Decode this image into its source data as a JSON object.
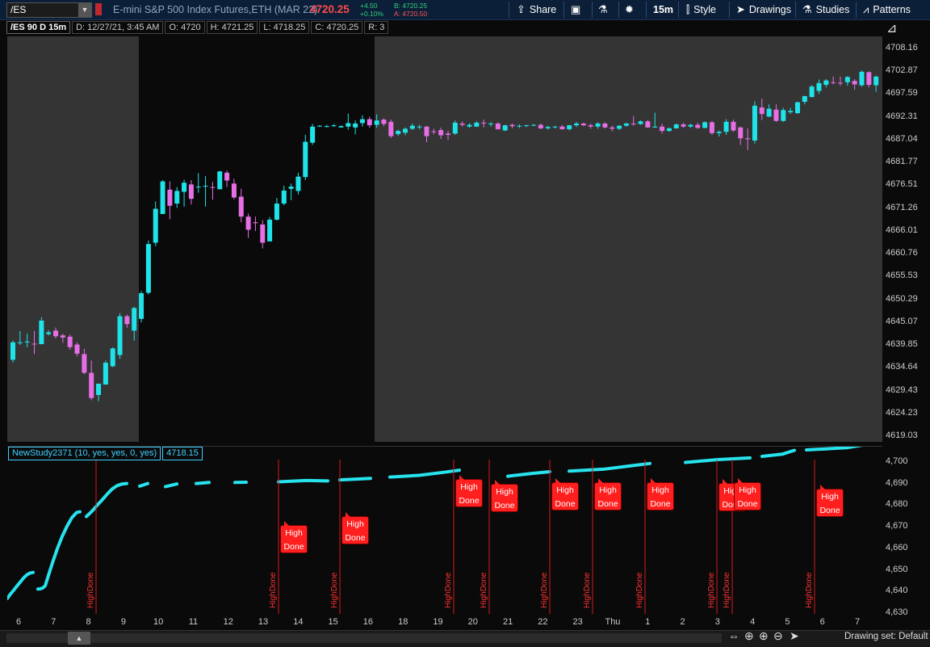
{
  "toolbar": {
    "symbol": "/ES",
    "instrument_name": "E-mini S&P 500 Index Futures,ETH (MAR 22)",
    "last_price": "4720.25",
    "net_change": "+4.50",
    "pct_change": "+0.10%",
    "bid": "B: 4720.25",
    "ask": "A: 4720.50",
    "share_label": "Share",
    "timeframe_label": "15m",
    "style_label": "Style",
    "drawings_label": "Drawings",
    "studies_label": "Studies",
    "patterns_label": "Patterns"
  },
  "chart_header": {
    "symbol_period": "/ES 90 D 15m",
    "date": "D: 12/27/21, 3:45 AM",
    "open": "O: 4720",
    "high": "H: 4721.25",
    "low": "L: 4718.25",
    "close": "C: 4720.25",
    "range": "R: 3"
  },
  "colors": {
    "up_candle": "#1fe3e8",
    "down_candle": "#e66fe6",
    "study_line": "#26e3ee",
    "high_done_marker": "#ff1f1f"
  },
  "price_axis": {
    "ticks": [
      "4708.16",
      "4702.87",
      "4697.59",
      "4692.31",
      "4687.04",
      "4681.77",
      "4676.51",
      "4671.26",
      "4666.01",
      "4660.76",
      "4655.53",
      "4650.29",
      "4645.07",
      "4639.85",
      "4634.64",
      "4629.43",
      "4624.23",
      "4619.03"
    ]
  },
  "study": {
    "name": "NewStudy2371 (10, yes, yes, 0, yes)",
    "value": "4718.15",
    "axis_ticks": [
      "4,700",
      "4,690",
      "4,680",
      "4,670",
      "4,660",
      "4,650",
      "4,640",
      "4,630"
    ],
    "vertical_label": "HighDone",
    "marker_line1": "High",
    "marker_line2": "Done"
  },
  "time_axis": {
    "ticks": [
      "6",
      "7",
      "8",
      "9",
      "10",
      "11",
      "12",
      "13",
      "14",
      "15",
      "16",
      "18",
      "19",
      "20",
      "21",
      "22",
      "23",
      "Thu",
      "1",
      "2",
      "3",
      "4",
      "5",
      "6",
      "7"
    ]
  },
  "bottom_bar": {
    "drawing_set": "Drawing set: Default"
  },
  "chart_data": {
    "type": "candlestick",
    "symbol": "/ES",
    "interval": "15m",
    "ylim": [
      4619.03,
      4708.16
    ],
    "candles": [
      {
        "o": 4636.6,
        "h": 4641.0,
        "l": 4636.0,
        "c": 4640.6
      },
      {
        "o": 4640.6,
        "h": 4643.2,
        "l": 4640.0,
        "c": 4640.6
      },
      {
        "o": 4640.6,
        "h": 4642.6,
        "l": 4639.5,
        "c": 4640.8
      },
      {
        "o": 4640.3,
        "h": 4643.2,
        "l": 4637.9,
        "c": 4640.2
      },
      {
        "o": 4640.2,
        "h": 4646.4,
        "l": 4640.1,
        "c": 4645.6
      },
      {
        "o": 4642.5,
        "h": 4643.4,
        "l": 4642.2,
        "c": 4642.9
      },
      {
        "o": 4643.3,
        "h": 4644.0,
        "l": 4641.5,
        "c": 4642.0
      },
      {
        "o": 4642.2,
        "h": 4642.6,
        "l": 4640.5,
        "c": 4641.7
      },
      {
        "o": 4641.9,
        "h": 4642.4,
        "l": 4638.9,
        "c": 4639.5
      },
      {
        "o": 4640.1,
        "h": 4640.6,
        "l": 4637.4,
        "c": 4638.0
      },
      {
        "o": 4637.9,
        "h": 4639.1,
        "l": 4633.3,
        "c": 4633.6
      },
      {
        "o": 4633.6,
        "h": 4636.4,
        "l": 4627.3,
        "c": 4627.8
      },
      {
        "o": 4628.5,
        "h": 4631.1,
        "l": 4627.1,
        "c": 4631.1
      },
      {
        "o": 4630.9,
        "h": 4636.4,
        "l": 4630.9,
        "c": 4635.9
      },
      {
        "o": 4635.1,
        "h": 4639.5,
        "l": 4634.9,
        "c": 4639.2
      },
      {
        "o": 4637.7,
        "h": 4647.3,
        "l": 4636.8,
        "c": 4646.6
      },
      {
        "o": 4646.6,
        "h": 4647.0,
        "l": 4644.0,
        "c": 4644.8
      },
      {
        "o": 4643.3,
        "h": 4648.8,
        "l": 4641.0,
        "c": 4648.5
      },
      {
        "o": 4646.0,
        "h": 4652.4,
        "l": 4645.2,
        "c": 4651.9
      },
      {
        "o": 4652.0,
        "h": 4664.0,
        "l": 4651.6,
        "c": 4663.2
      },
      {
        "o": 4663.5,
        "h": 4673.0,
        "l": 4662.7,
        "c": 4671.3
      },
      {
        "o": 4670.1,
        "h": 4677.9,
        "l": 4670.2,
        "c": 4677.6
      },
      {
        "o": 4675.7,
        "h": 4677.6,
        "l": 4668.9,
        "c": 4672.0
      },
      {
        "o": 4672.5,
        "h": 4676.3,
        "l": 4671.5,
        "c": 4675.4
      },
      {
        "o": 4675.2,
        "h": 4678.0,
        "l": 4671.8,
        "c": 4677.3
      },
      {
        "o": 4676.9,
        "h": 4677.9,
        "l": 4672.3,
        "c": 4673.6
      },
      {
        "o": 4676.3,
        "h": 4679.5,
        "l": 4675.0,
        "c": 4676.4
      },
      {
        "o": 4676.5,
        "h": 4678.8,
        "l": 4671.8,
        "c": 4676.6
      },
      {
        "o": 4676.3,
        "h": 4677.5,
        "l": 4673.4,
        "c": 4676.2
      },
      {
        "o": 4675.8,
        "h": 4680.0,
        "l": 4675.8,
        "c": 4679.9
      },
      {
        "o": 4679.6,
        "h": 4680.1,
        "l": 4676.3,
        "c": 4677.8
      },
      {
        "o": 4677.1,
        "h": 4678.2,
        "l": 4673.5,
        "c": 4673.9
      },
      {
        "o": 4674.1,
        "h": 4675.9,
        "l": 4668.2,
        "c": 4669.5
      },
      {
        "o": 4669.5,
        "h": 4670.2,
        "l": 4664.6,
        "c": 4666.5
      },
      {
        "o": 4668.2,
        "h": 4669.5,
        "l": 4666.2,
        "c": 4668.0
      },
      {
        "o": 4667.7,
        "h": 4668.7,
        "l": 4662.2,
        "c": 4663.5
      },
      {
        "o": 4663.8,
        "h": 4669.4,
        "l": 4664.0,
        "c": 4668.8
      },
      {
        "o": 4668.8,
        "h": 4673.8,
        "l": 4668.6,
        "c": 4672.5
      },
      {
        "o": 4672.5,
        "h": 4676.6,
        "l": 4672.1,
        "c": 4675.5
      },
      {
        "o": 4675.9,
        "h": 4677.1,
        "l": 4673.3,
        "c": 4676.4
      },
      {
        "o": 4675.4,
        "h": 4679.6,
        "l": 4674.6,
        "c": 4678.7
      },
      {
        "o": 4678.6,
        "h": 4688.3,
        "l": 4677.9,
        "c": 4686.7
      },
      {
        "o": 4686.5,
        "h": 4690.8,
        "l": 4686.0,
        "c": 4690.2
      },
      {
        "o": 4690.3,
        "h": 4690.5,
        "l": 4690.1,
        "c": 4690.4
      },
      {
        "o": 4690.2,
        "h": 4690.6,
        "l": 4690.0,
        "c": 4690.3
      },
      {
        "o": 4690.4,
        "h": 4690.8,
        "l": 4690.1,
        "c": 4690.5
      },
      {
        "o": 4690.0,
        "h": 4690.5,
        "l": 4690.0,
        "c": 4690.3
      },
      {
        "o": 4690.2,
        "h": 4693.2,
        "l": 4689.5,
        "c": 4691.0
      },
      {
        "o": 4690.0,
        "h": 4691.6,
        "l": 4688.4,
        "c": 4690.9
      },
      {
        "o": 4691.0,
        "h": 4692.8,
        "l": 4690.2,
        "c": 4691.9
      },
      {
        "o": 4691.9,
        "h": 4692.5,
        "l": 4689.9,
        "c": 4690.5
      },
      {
        "o": 4690.6,
        "h": 4693.0,
        "l": 4689.9,
        "c": 4691.6
      },
      {
        "o": 4691.8,
        "h": 4692.1,
        "l": 4690.3,
        "c": 4690.8
      },
      {
        "o": 4691.3,
        "h": 4691.8,
        "l": 4687.6,
        "c": 4688.0
      },
      {
        "o": 4688.5,
        "h": 4689.5,
        "l": 4688.1,
        "c": 4689.2
      },
      {
        "o": 4688.8,
        "h": 4690.0,
        "l": 4688.2,
        "c": 4689.7
      },
      {
        "o": 4689.7,
        "h": 4690.9,
        "l": 4689.4,
        "c": 4690.4
      },
      {
        "o": 4690.1,
        "h": 4690.6,
        "l": 4689.6,
        "c": 4690.2
      },
      {
        "o": 4690.2,
        "h": 4690.3,
        "l": 4686.6,
        "c": 4688.0
      },
      {
        "o": 4689.1,
        "h": 4689.7,
        "l": 4688.4,
        "c": 4689.0
      },
      {
        "o": 4689.4,
        "h": 4690.0,
        "l": 4687.4,
        "c": 4688.2
      },
      {
        "o": 4688.6,
        "h": 4689.2,
        "l": 4687.1,
        "c": 4688.3
      },
      {
        "o": 4688.6,
        "h": 4691.6,
        "l": 4688.3,
        "c": 4691.1
      },
      {
        "o": 4690.9,
        "h": 4691.4,
        "l": 4690.2,
        "c": 4690.6
      },
      {
        "o": 4690.2,
        "h": 4691.0,
        "l": 4689.9,
        "c": 4690.6
      },
      {
        "o": 4690.2,
        "h": 4691.4,
        "l": 4690.1,
        "c": 4691.1
      },
      {
        "o": 4691.1,
        "h": 4691.8,
        "l": 4690.0,
        "c": 4691.0
      },
      {
        "o": 4690.8,
        "h": 4691.2,
        "l": 4690.2,
        "c": 4690.9
      },
      {
        "o": 4690.9,
        "h": 4691.2,
        "l": 4689.5,
        "c": 4689.6
      },
      {
        "o": 4689.3,
        "h": 4690.6,
        "l": 4689.2,
        "c": 4690.5
      },
      {
        "o": 4690.6,
        "h": 4690.9,
        "l": 4689.8,
        "c": 4690.3
      },
      {
        "o": 4690.3,
        "h": 4690.7,
        "l": 4689.9,
        "c": 4690.4
      },
      {
        "o": 4690.4,
        "h": 4690.6,
        "l": 4690.1,
        "c": 4690.5
      },
      {
        "o": 4690.6,
        "h": 4690.8,
        "l": 4690.3,
        "c": 4690.6
      },
      {
        "o": 4690.6,
        "h": 4690.9,
        "l": 4689.6,
        "c": 4689.8
      },
      {
        "o": 4689.8,
        "h": 4690.4,
        "l": 4689.5,
        "c": 4690.1
      },
      {
        "o": 4690.1,
        "h": 4690.4,
        "l": 4689.8,
        "c": 4690.2
      },
      {
        "o": 4690.2,
        "h": 4690.6,
        "l": 4689.5,
        "c": 4689.6
      },
      {
        "o": 4689.6,
        "h": 4690.6,
        "l": 4689.3,
        "c": 4690.5
      },
      {
        "o": 4690.5,
        "h": 4691.3,
        "l": 4690.1,
        "c": 4690.9
      },
      {
        "o": 4690.9,
        "h": 4691.1,
        "l": 4690.3,
        "c": 4690.5
      },
      {
        "o": 4690.5,
        "h": 4690.9,
        "l": 4689.7,
        "c": 4690.2
      },
      {
        "o": 4690.2,
        "h": 4691.2,
        "l": 4689.7,
        "c": 4690.9
      },
      {
        "o": 4690.9,
        "h": 4691.2,
        "l": 4689.8,
        "c": 4690.0
      },
      {
        "o": 4690.0,
        "h": 4690.4,
        "l": 4689.1,
        "c": 4689.7
      },
      {
        "o": 4689.7,
        "h": 4690.5,
        "l": 4689.4,
        "c": 4690.4
      },
      {
        "o": 4690.4,
        "h": 4691.1,
        "l": 4690.2,
        "c": 4690.9
      },
      {
        "o": 4690.9,
        "h": 4692.6,
        "l": 4690.4,
        "c": 4690.8
      },
      {
        "o": 4690.8,
        "h": 4691.6,
        "l": 4690.6,
        "c": 4691.4
      },
      {
        "o": 4691.4,
        "h": 4691.7,
        "l": 4690.0,
        "c": 4690.0
      },
      {
        "o": 4690.0,
        "h": 4693.4,
        "l": 4689.9,
        "c": 4690.2
      },
      {
        "o": 4690.2,
        "h": 4690.9,
        "l": 4688.6,
        "c": 4689.2
      },
      {
        "o": 4689.2,
        "h": 4690.0,
        "l": 4689.0,
        "c": 4689.8
      },
      {
        "o": 4689.8,
        "h": 4690.9,
        "l": 4689.7,
        "c": 4690.7
      },
      {
        "o": 4690.7,
        "h": 4691.1,
        "l": 4689.9,
        "c": 4690.2
      },
      {
        "o": 4690.2,
        "h": 4690.8,
        "l": 4689.9,
        "c": 4690.6
      },
      {
        "o": 4690.6,
        "h": 4691.1,
        "l": 4689.7,
        "c": 4689.9
      },
      {
        "o": 4689.9,
        "h": 4691.4,
        "l": 4689.8,
        "c": 4691.2
      },
      {
        "o": 4691.2,
        "h": 4691.5,
        "l": 4688.3,
        "c": 4688.7
      },
      {
        "o": 4688.7,
        "h": 4689.3,
        "l": 4687.9,
        "c": 4689.0
      },
      {
        "o": 4689.0,
        "h": 4691.9,
        "l": 4688.3,
        "c": 4691.3
      },
      {
        "o": 4691.3,
        "h": 4691.8,
        "l": 4689.0,
        "c": 4689.3
      },
      {
        "o": 4690.0,
        "h": 4690.2,
        "l": 4686.0,
        "c": 4687.5
      },
      {
        "o": 4687.5,
        "h": 4689.8,
        "l": 4684.8,
        "c": 4687.3
      },
      {
        "o": 4687.0,
        "h": 4696.0,
        "l": 4686.3,
        "c": 4695.0
      },
      {
        "o": 4694.6,
        "h": 4696.6,
        "l": 4691.7,
        "c": 4693.1
      },
      {
        "o": 4692.5,
        "h": 4695.3,
        "l": 4692.4,
        "c": 4694.3
      },
      {
        "o": 4694.1,
        "h": 4695.3,
        "l": 4691.3,
        "c": 4691.5
      },
      {
        "o": 4691.5,
        "h": 4694.5,
        "l": 4691.3,
        "c": 4694.0
      },
      {
        "o": 4693.5,
        "h": 4694.5,
        "l": 4693.1,
        "c": 4693.8
      },
      {
        "o": 4693.3,
        "h": 4695.9,
        "l": 4693.1,
        "c": 4695.8
      },
      {
        "o": 4695.9,
        "h": 4697.3,
        "l": 4695.3,
        "c": 4697.2
      },
      {
        "o": 4697.0,
        "h": 4699.8,
        "l": 4696.9,
        "c": 4699.4
      },
      {
        "o": 4698.4,
        "h": 4701.0,
        "l": 4697.7,
        "c": 4700.2
      },
      {
        "o": 4699.8,
        "h": 4701.1,
        "l": 4699.2,
        "c": 4700.8
      },
      {
        "o": 4700.4,
        "h": 4701.7,
        "l": 4699.9,
        "c": 4700.3
      },
      {
        "o": 4700.3,
        "h": 4701.7,
        "l": 4699.6,
        "c": 4700.2
      },
      {
        "o": 4700.4,
        "h": 4701.8,
        "l": 4699.6,
        "c": 4701.6
      },
      {
        "o": 4700.7,
        "h": 4701.1,
        "l": 4698.7,
        "c": 4699.9
      },
      {
        "o": 4699.7,
        "h": 4703.1,
        "l": 4699.4,
        "c": 4702.8
      },
      {
        "o": 4702.7,
        "h": 4702.9,
        "l": 4699.2,
        "c": 4699.8
      },
      {
        "o": 4699.7,
        "h": 4701.9,
        "l": 4698.2,
        "c": 4701.7
      }
    ],
    "study_series": {
      "name": "NewStudy2371",
      "ylim": [
        4630,
        4700
      ],
      "segments": [
        [
          [
            0,
            4637.1
          ],
          [
            4,
            4639.2
          ],
          [
            8,
            4641.0
          ],
          [
            12,
            4642.9
          ],
          [
            16,
            4644.7
          ],
          [
            20,
            4646.6
          ],
          [
            24,
            4648.0
          ],
          [
            28,
            4648.9
          ],
          [
            32,
            4649.2
          ]
        ],
        [
          [
            38,
            4641.5
          ],
          [
            41,
            4641.6
          ],
          [
            44,
            4642.0
          ],
          [
            47,
            4643.0
          ],
          [
            51,
            4647.8
          ],
          [
            56,
            4653.7
          ],
          [
            62,
            4660.2
          ],
          [
            68,
            4665.9
          ],
          [
            74,
            4670.6
          ],
          [
            80,
            4674.6
          ],
          [
            86,
            4677.0
          ],
          [
            90,
            4677.3
          ]
        ],
        [
          [
            98,
            4675.1
          ],
          [
            105,
            4677.6
          ],
          [
            112,
            4680.6
          ],
          [
            118,
            4683.0
          ],
          [
            124,
            4685.6
          ],
          [
            130,
            4687.9
          ],
          [
            136,
            4689.4
          ],
          [
            142,
            4690.2
          ],
          [
            148,
            4690.4
          ]
        ],
        [
          [
            164,
            4689.2
          ],
          [
            174,
            4690.4
          ]
        ],
        [
          [
            196,
            4689.0
          ],
          [
            210,
            4690.2
          ]
        ],
        [
          [
            234,
            4690.4
          ],
          [
            250,
            4690.9
          ]
        ],
        [
          [
            282,
            4690.9
          ],
          [
            296,
            4691.0
          ]
        ],
        [
          [
            336,
            4691.2
          ],
          [
            370,
            4691.8
          ],
          [
            397,
            4691.6
          ]
        ],
        [
          [
            412,
            4692.1
          ],
          [
            430,
            4692.4
          ],
          [
            450,
            4692.8
          ]
        ],
        [
          [
            474,
            4693.4
          ],
          [
            510,
            4694.2
          ],
          [
            540,
            4695.6
          ],
          [
            560,
            4696.6
          ]
        ],
        [
          [
            620,
            4693.8
          ],
          [
            650,
            4695.1
          ],
          [
            672,
            4695.9
          ]
        ],
        [
          [
            696,
            4696.2
          ],
          [
            740,
            4697.1
          ],
          [
            770,
            4698.5
          ],
          [
            796,
            4699.7
          ]
        ],
        [
          [
            840,
            4700.2
          ],
          [
            880,
            4701.5
          ],
          [
            920,
            4702.3
          ]
        ],
        [
          [
            935,
            4703.0
          ],
          [
            960,
            4704.0
          ],
          [
            975,
            4705.8
          ]
        ],
        [
          [
            990,
            4706.0
          ],
          [
            1040,
            4707.0
          ],
          [
            1080,
            4709.5
          ]
        ]
      ]
    },
    "high_done_markers": [
      {
        "x_index": 1
      },
      {
        "x_index": 2,
        "label_y": 4665.0
      },
      {
        "x_index": 3,
        "label_y": 4669.0
      },
      {
        "x_index": 4,
        "label_y": 4686.0
      },
      {
        "x_index": 5,
        "label_y": 4684.0
      },
      {
        "x_index": 6,
        "label_y": 4684.5
      },
      {
        "x_index": 7,
        "label_y": 4684.8
      },
      {
        "x_index": 8,
        "label_y": 4684.6
      },
      {
        "x_index": 9,
        "label_y": 4684.3
      },
      {
        "x_index": 10,
        "label_y": 4684.8
      },
      {
        "x_index": 11,
        "label_y": 4681.8
      }
    ]
  }
}
